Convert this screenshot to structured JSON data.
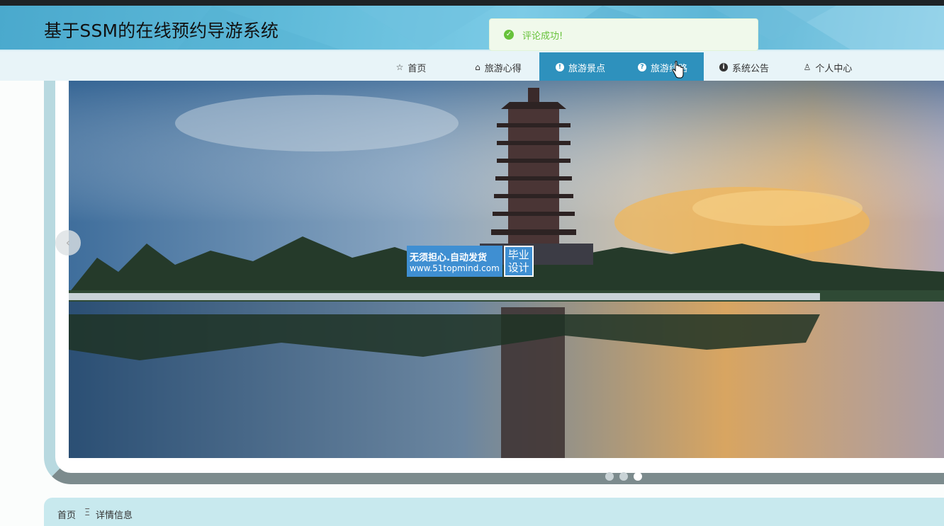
{
  "header": {
    "title": "基于SSM的在线预约导游系统"
  },
  "toast": {
    "message": "评论成功!",
    "icon": "check-circle-icon",
    "color": "#67c23a"
  },
  "nav": {
    "items": [
      {
        "label": "首页",
        "icon": "star-icon",
        "active": false
      },
      {
        "label": "旅游心得",
        "icon": "bag-icon",
        "active": false
      },
      {
        "label": "旅游景点",
        "icon": "info-icon",
        "active": true
      },
      {
        "label": "旅游线路",
        "icon": "help-icon",
        "active": true
      },
      {
        "label": "系统公告",
        "icon": "info-icon",
        "active": false
      },
      {
        "label": "个人中心",
        "icon": "user-icon",
        "active": false
      }
    ],
    "active_color": "#2e91bd"
  },
  "carousel": {
    "slide_count": 3,
    "active_index": 2,
    "watermark": {
      "line1": "无须担心.自动发货",
      "line2": "www.51topmind.com",
      "badge_line1": "毕业",
      "badge_line2": "设计"
    }
  },
  "breadcrumb": {
    "home": "首页",
    "separator": "Ξ",
    "current": "详情信息"
  }
}
